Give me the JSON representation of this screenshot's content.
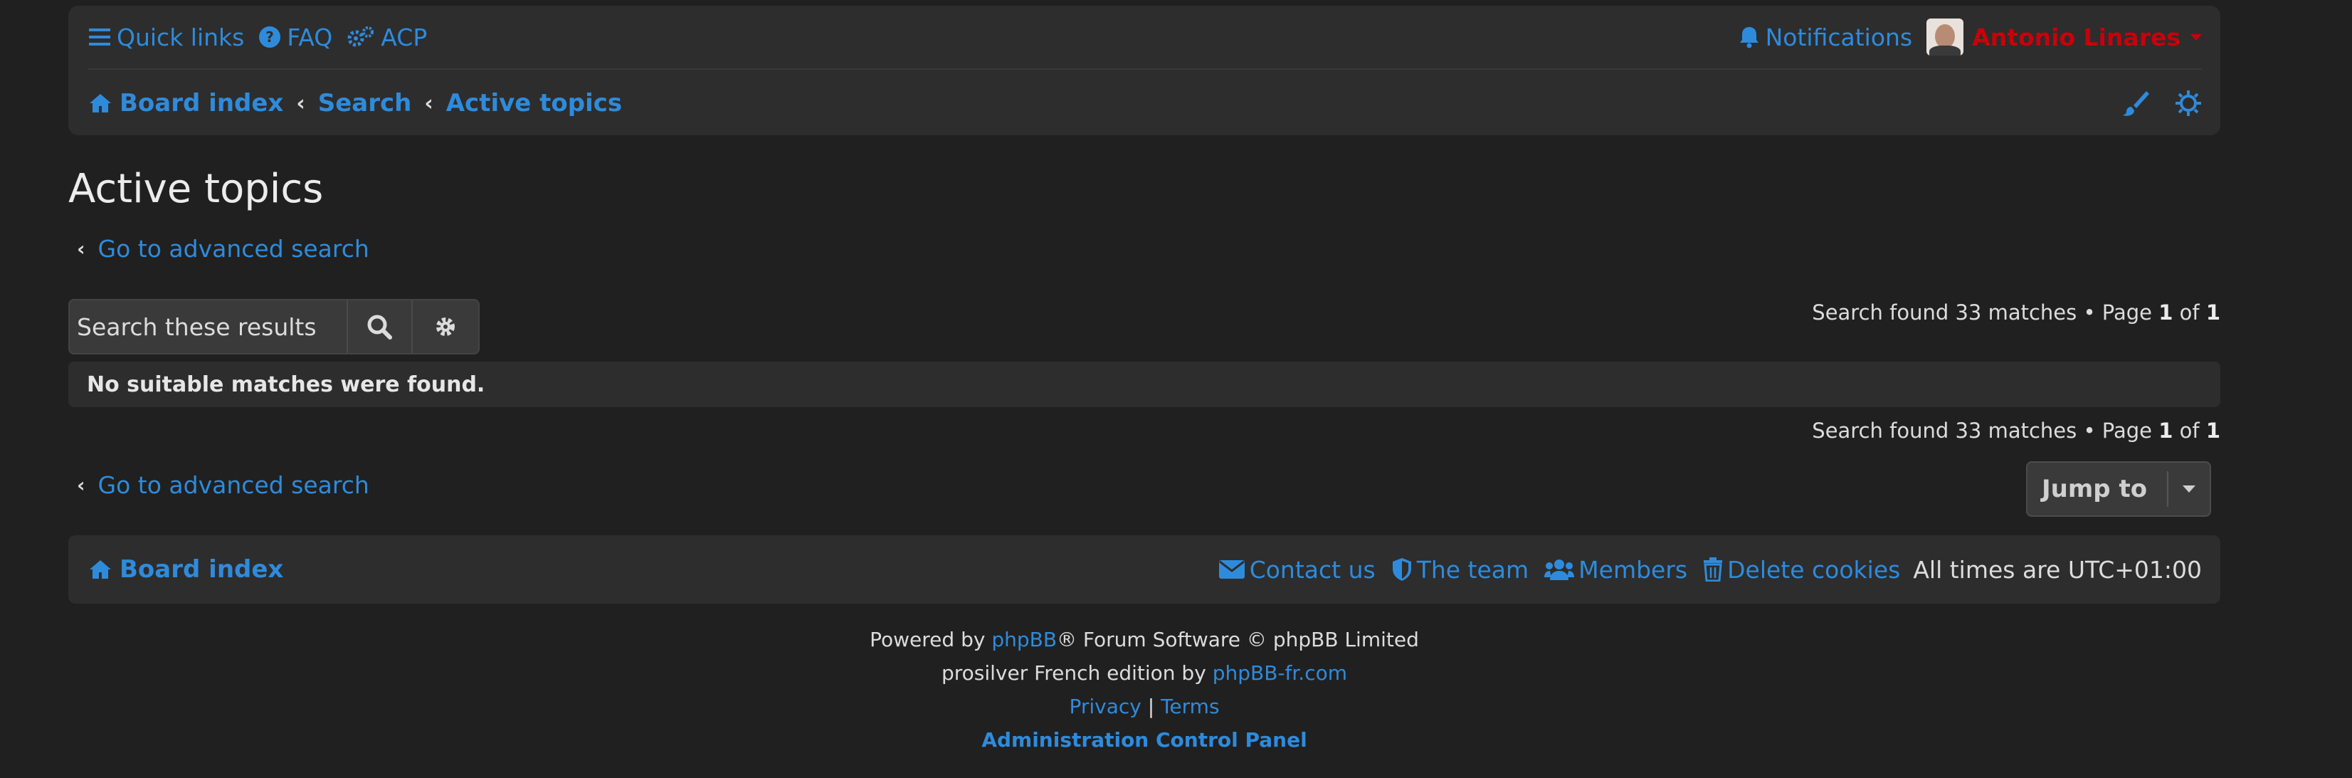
{
  "header": {
    "quick_links": "Quick links",
    "faq": "FAQ",
    "acp": "ACP",
    "notifications": "Notifications",
    "username": "Antonio Linares",
    "username_color": "#c8000a"
  },
  "breadcrumbs": {
    "board_index": "Board index",
    "search": "Search",
    "active_topics": "Active topics"
  },
  "page": {
    "title": "Active topics",
    "advanced_search_link": "Go to advanced search"
  },
  "search": {
    "placeholder": "Search these results"
  },
  "results": {
    "prefix": "Search found 33 matches • Page ",
    "page": "1",
    "of": " of ",
    "total_pages": "1"
  },
  "message": "No suitable matches were found.",
  "jump_to": "Jump to",
  "footer": {
    "board_index": "Board index",
    "contact_us": "Contact us",
    "the_team": "The team",
    "members": "Members",
    "delete_cookies": "Delete cookies",
    "timezone": "All times are UTC+01:00"
  },
  "credits": {
    "powered_by": "Powered by ",
    "phpbb": "phpBB",
    "powered_suffix": "® Forum Software © phpBB Limited",
    "french_edition": "prosilver French edition by ",
    "phpbb_fr": "phpBB-fr.com",
    "privacy": "Privacy",
    "separator": " | ",
    "terms": "Terms",
    "acp_link": "Administration Control Panel"
  },
  "colors": {
    "link": "#2e8bdc",
    "background": "#202020",
    "panel": "#2d2d2d"
  }
}
